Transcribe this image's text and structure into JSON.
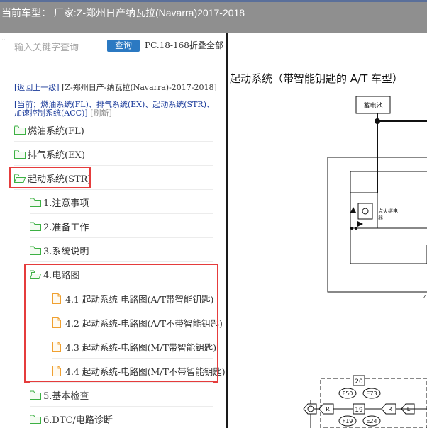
{
  "window": {
    "title": "当前车型： 厂家:Z-郑州日产纳瓦拉(Navarra)2017-2018"
  },
  "left_panel": {
    "corner_marker": "..",
    "search": {
      "placeholder": "输入关键字查询",
      "button_label": "查询"
    },
    "pc_collapse_label": "PC.18-168折叠全部",
    "breadcrumb": {
      "back_label": "[返回上一级]",
      "path_text": "[Z-郑州日产-纳瓦拉(Navarra)-2017-2018]"
    },
    "current": {
      "prefix": "[当前：",
      "items_text": "燃油系统(FL)、排气系统(EX)、起动系统(STR)、加速控制系统(ACC)]",
      "refresh_label": "[刷新]"
    },
    "tree": [
      {
        "label": "燃油系统(FL)",
        "type": "folder",
        "state": "closed"
      },
      {
        "label": "排气系统(EX)",
        "type": "folder",
        "state": "closed"
      },
      {
        "label": "起动系统(STR)",
        "type": "folder",
        "state": "open",
        "highlighted": true
      },
      {
        "label": "1.注意事项",
        "type": "folder",
        "state": "closed"
      },
      {
        "label": "2.准备工作",
        "type": "folder",
        "state": "closed"
      },
      {
        "label": "3.系统说明",
        "type": "folder",
        "state": "closed"
      },
      {
        "label": "4.电路图",
        "type": "folder",
        "state": "open",
        "highlighted": true
      },
      {
        "label": "4.1 起动系统-电路图(A/T带智能钥匙)",
        "type": "document"
      },
      {
        "label": "4.2 起动系统-电路图(A/T不带智能钥匙)",
        "type": "document"
      },
      {
        "label": "4.3 起动系统-电路图(M/T带智能钥匙)",
        "type": "document"
      },
      {
        "label": "4.4 起动系统-电路图(M/T不带智能钥匙)",
        "type": "document"
      },
      {
        "label": "5.基本检查",
        "type": "folder",
        "state": "closed"
      },
      {
        "label": "6.DTC/电路诊断",
        "type": "folder",
        "state": "closed"
      }
    ]
  },
  "diagram": {
    "title": "起动系统（带智能钥匙的 A/T 车型）",
    "battery_label": "蓄电池",
    "relay_label_line1": "点火继电",
    "relay_label_line2": "器",
    "page_number": "4",
    "connector_top": "20",
    "connector_mid": "19",
    "connector_labels": [
      "F50",
      "E73",
      "F19",
      "E24"
    ],
    "wire_labels": [
      "L",
      "L",
      "R",
      "R"
    ]
  },
  "colors": {
    "titlebar": "#8f8f8f",
    "search_button": "#2b79c2",
    "link": "#1a3a9a",
    "highlight_box": "#e53c3c",
    "folder_green": "#3cb043",
    "document_orange": "#f0a030"
  }
}
